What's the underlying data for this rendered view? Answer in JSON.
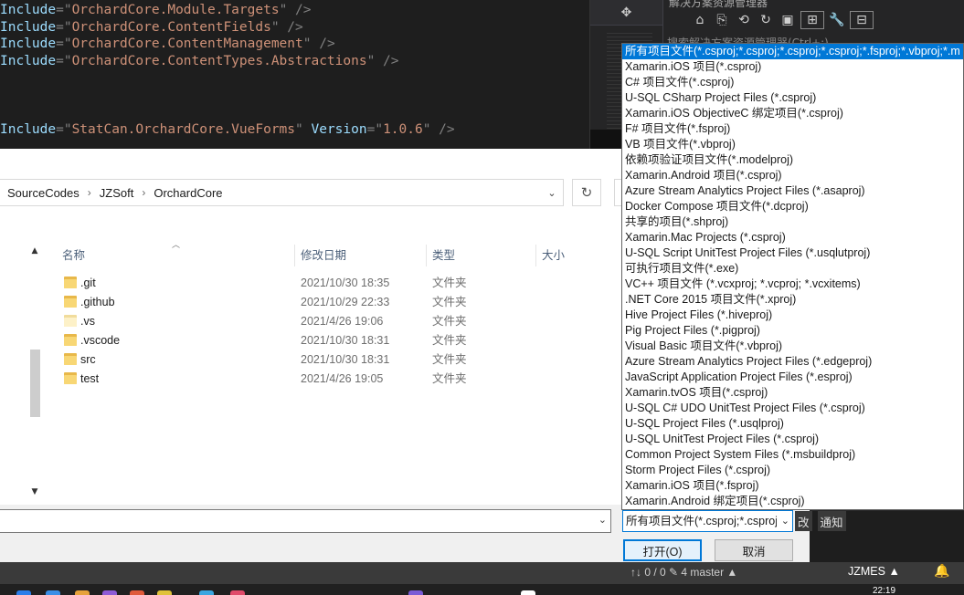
{
  "editor": {
    "lines": [
      {
        "kw": "Include",
        "value": "OrchardCore.Module.Targets",
        "tail": " />"
      },
      {
        "kw": "Include",
        "value": "OrchardCore.ContentFields",
        "tail": " />"
      },
      {
        "kw": "Include",
        "value": "OrchardCore.ContentManagement",
        "tail": " />"
      },
      {
        "kw": "Include",
        "value": "OrchardCore.ContentTypes.Abstractions",
        "tail": " />"
      },
      {
        "kw": "Include",
        "value": "StatCan.OrchardCore.VueForms",
        "attr2": "Version",
        "value2": "1.0.6",
        "tail": " />"
      }
    ]
  },
  "right_panel": {
    "title_partial": "解决方案资源管理器",
    "search_placeholder_partial": "搜索解决方案资源管理器(Ctrl+;)"
  },
  "dialog": {
    "breadcrumb": [
      "SourceCodes",
      "JZSoft",
      "OrchardCore"
    ],
    "columns": {
      "name": "名称",
      "date": "修改日期",
      "type": "类型",
      "size": "大小"
    },
    "files": [
      {
        "name": ".git",
        "date": "2021/10/30 18:35",
        "type": "文件夹",
        "hidden": false
      },
      {
        "name": ".github",
        "date": "2021/10/29 22:33",
        "type": "文件夹",
        "hidden": false
      },
      {
        "name": ".vs",
        "date": "2021/4/26 19:06",
        "type": "文件夹",
        "hidden": true
      },
      {
        "name": ".vscode",
        "date": "2021/10/30 18:31",
        "type": "文件夹",
        "hidden": false
      },
      {
        "name": "src",
        "date": "2021/10/30 18:31",
        "type": "文件夹",
        "hidden": false
      },
      {
        "name": "test",
        "date": "2021/4/26 19:05",
        "type": "文件夹",
        "hidden": false
      }
    ],
    "filename_value": "",
    "filter_selected": "所有项目文件(*.csproj;*.csproj;*.csproj;*.csproj;*.fsproj;*.vbproj;*.m",
    "open_label": "打开(O)",
    "cancel_label": "取消",
    "filter_options": [
      "所有项目文件(*.csproj;*.csproj;*.csproj;*.csproj;*.fsproj;*.vbproj;*.m",
      "Xamarin.iOS 项目(*.csproj)",
      "C# 项目文件(*.csproj)",
      "U-SQL CSharp Project Files (*.csproj)",
      "Xamarin.iOS ObjectiveC 绑定项目(*.csproj)",
      "F# 项目文件(*.fsproj)",
      "VB 项目文件(*.vbproj)",
      "依赖项验证项目文件(*.modelproj)",
      "Xamarin.Android 项目(*.csproj)",
      "Azure Stream Analytics Project Files (*.asaproj)",
      "Docker Compose 项目文件(*.dcproj)",
      "共享的项目(*.shproj)",
      "Xamarin.Mac Projects (*.csproj)",
      "U-SQL Script UnitTest Project Files (*.usqlutproj)",
      "可执行项目文件(*.exe)",
      "VC++ 项目文件 (*.vcxproj; *.vcproj; *.vcxitems)",
      ".NET Core 2015 项目文件(*.xproj)",
      "Hive Project Files (*.hiveproj)",
      "Pig Project Files (*.pigproj)",
      "Visual Basic 项目文件(*.vbproj)",
      "Azure Stream Analytics Project Files (*.edgeproj)",
      "JavaScript Application Project Files (*.esproj)",
      "Xamarin.tvOS 项目(*.csproj)",
      "U-SQL C# UDO UnitTest Project Files (*.csproj)",
      "U-SQL Project Files (*.usqlproj)",
      "U-SQL UnitTest Project Files (*.csproj)",
      "Common Project System Files (*.msbuildproj)",
      "Storm Project Files (*.csproj)",
      "Xamarin.iOS 项目(*.fsproj)",
      "Xamarin.Android 绑定项目(*.csproj)"
    ]
  },
  "vs": {
    "tabs": [
      "改",
      "通知"
    ],
    "status_left": "↑↓ 0 / 0    ✎ 4    master ▲",
    "project": "JZMES ▲",
    "clock_partial": "22:19"
  }
}
